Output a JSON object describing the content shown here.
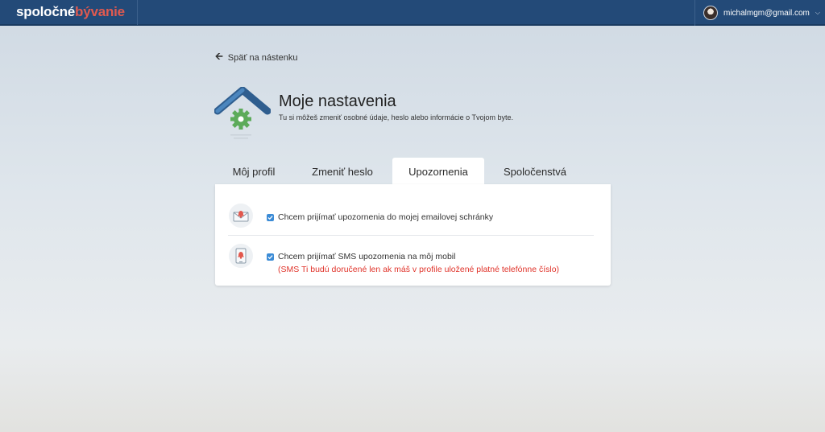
{
  "header": {
    "logo_part1": "spoločné",
    "logo_part2": "bývanie",
    "user_email": "michalmgm@gmail.com"
  },
  "back_link": {
    "label": "Späť na nástenku"
  },
  "page": {
    "title": "Moje nastavenia",
    "subtitle": "Tu si môžeš zmeniť osobné údaje, heslo alebo informácie o Tvojom byte."
  },
  "tabs": [
    {
      "label": "Môj profil",
      "active": false
    },
    {
      "label": "Zmeniť heslo",
      "active": false
    },
    {
      "label": "Upozornenia",
      "active": true
    },
    {
      "label": "Spoločenstvá",
      "active": false
    }
  ],
  "notifications": [
    {
      "icon": "email-bell-icon",
      "label": "Chcem prijímať upozornenia do mojej emailovej schránky",
      "checked": true
    },
    {
      "icon": "mobile-bell-icon",
      "label": "Chcem prijímať SMS upozornenia na môj mobil",
      "note": "(SMS Ti budú doručené len ak máš v profile uložené platné telefónne číslo)",
      "checked": true
    }
  ],
  "colors": {
    "header_bg": "#234a78",
    "brand_accent": "#e05a50",
    "checkbox": "#3b8bd6",
    "warning_text": "#e0332a"
  }
}
